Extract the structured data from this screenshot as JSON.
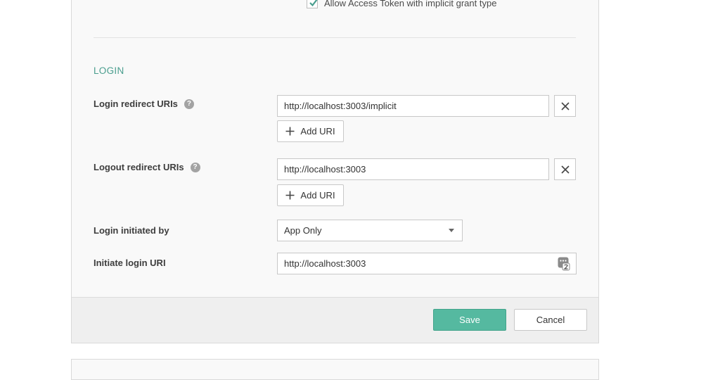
{
  "grant_types": {
    "implicit_access_token_label": "Allow Access Token with implicit grant type",
    "implicit_access_token_checked": true
  },
  "login_section": {
    "title": "LOGIN",
    "help_icon_glyph": "?",
    "login_redirect": {
      "label": "Login redirect URIs",
      "uris": [
        "http://localhost:3003/implicit"
      ],
      "add_label": "Add URI"
    },
    "logout_redirect": {
      "label": "Logout redirect URIs",
      "uris": [
        "http://localhost:3003"
      ],
      "add_label": "Add URI"
    },
    "login_initiated_by": {
      "label": "Login initiated by",
      "selected": "App Only"
    },
    "initiate_login_uri": {
      "label": "Initiate login URI",
      "value": "http://localhost:3003"
    }
  },
  "footer": {
    "save_label": "Save",
    "cancel_label": "Cancel"
  },
  "colors": {
    "accent": "#55b9a0",
    "section_title": "#4a9e8e"
  }
}
